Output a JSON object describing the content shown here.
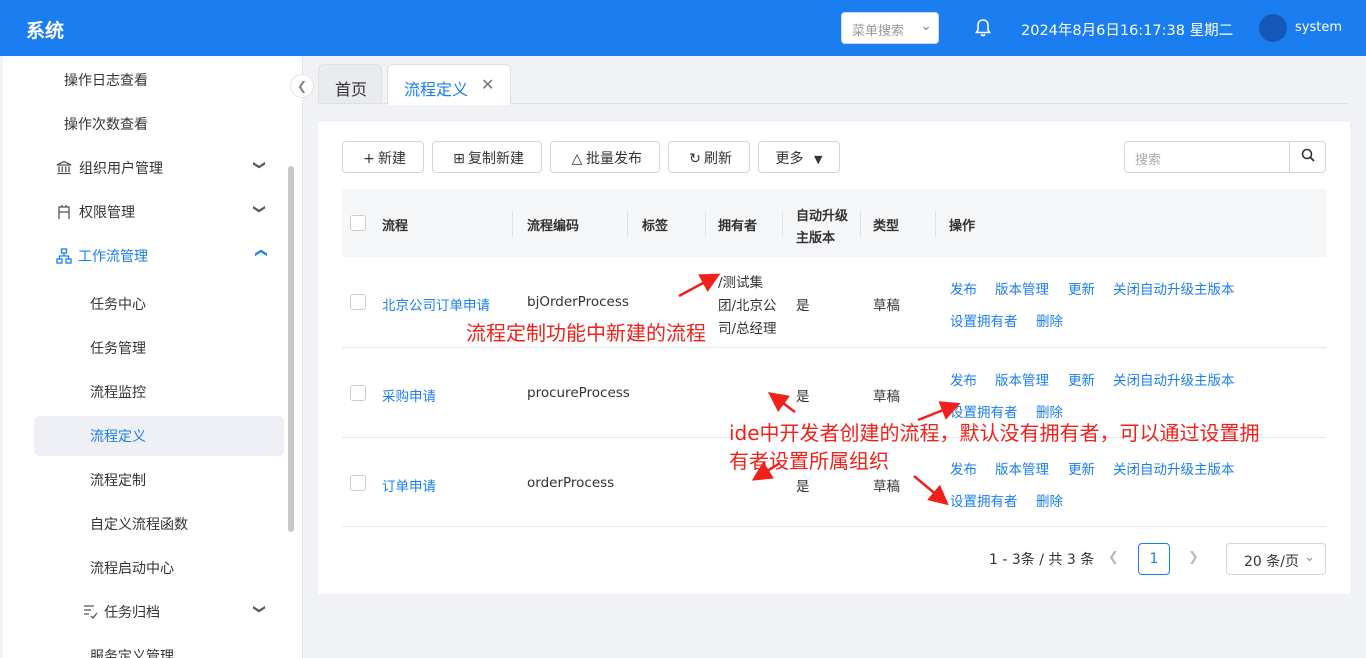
{
  "header": {
    "app_title": "系统",
    "menu_search_placeholder": "菜单搜索",
    "datetime": "2024年8月6日16:17:38 星期二",
    "username": "system"
  },
  "sidebar": {
    "items": [
      {
        "label": "操作日志查看"
      },
      {
        "label": "操作次数查看"
      },
      {
        "label": "组织用户管理",
        "icon": "bank-icon"
      },
      {
        "label": "权限管理",
        "icon": "badge-icon"
      },
      {
        "label": "工作流管理",
        "icon": "sitemap-icon"
      },
      {
        "label": "任务中心"
      },
      {
        "label": "任务管理"
      },
      {
        "label": "流程监控"
      },
      {
        "label": "流程定义"
      },
      {
        "label": "流程定制"
      },
      {
        "label": "自定义流程函数"
      },
      {
        "label": "流程启动中心"
      },
      {
        "label": "任务归档",
        "icon": "archive-icon"
      },
      {
        "label": "服务定义管理"
      }
    ]
  },
  "tabs": {
    "home": "首页",
    "active": "流程定义"
  },
  "toolbar": {
    "new_label": "新建",
    "copy_new_label": "复制新建",
    "batch_publish_label": "批量发布",
    "refresh_label": "刷新",
    "more_label": "更多",
    "search_placeholder": "搜索"
  },
  "table": {
    "headers": {
      "process": "流程",
      "code": "流程编码",
      "tags": "标签",
      "owner": "拥有者",
      "auto_upgrade_line1": "自动升级",
      "auto_upgrade_line2": "主版本",
      "type": "类型",
      "actions": "操作"
    },
    "rows": [
      {
        "name": "北京公司订单申请",
        "code": "bjOrderProcess",
        "owner_line1": "/测试集",
        "owner_line2": "团/北京公",
        "owner_line3": "司/总经理",
        "auto_upgrade": "是",
        "type": "草稿",
        "actions": [
          "发布",
          "版本管理",
          "更新",
          "关闭自动升级主版本",
          "设置拥有者",
          "删除"
        ]
      },
      {
        "name": "采购申请",
        "code": "procureProcess",
        "owner_line1": "",
        "owner_line2": "",
        "owner_line3": "",
        "auto_upgrade": "是",
        "type": "草稿",
        "actions": [
          "发布",
          "版本管理",
          "更新",
          "关闭自动升级主版本",
          "设置拥有者",
          "删除"
        ]
      },
      {
        "name": "订单申请",
        "code": "orderProcess",
        "owner_line1": "",
        "owner_line2": "",
        "owner_line3": "",
        "auto_upgrade": "是",
        "type": "草稿",
        "actions": [
          "发布",
          "版本管理",
          "更新",
          "关闭自动升级主版本",
          "设置拥有者",
          "删除"
        ]
      }
    ]
  },
  "pagination": {
    "total_text": "1 - 3条 / 共 3 条",
    "current_page": "1",
    "page_size": "20 条/页"
  },
  "annotations": {
    "note1": "流程定制功能中新建的流程",
    "note2_line1": "ide中开发者创建的流程，默认没有拥有者，可以通过设置拥",
    "note2_line2": "有者设置所属组织",
    "color": "#f0211b"
  },
  "colors": {
    "primary": "#1b7ef0",
    "header_bg": "#1b7ef0"
  }
}
